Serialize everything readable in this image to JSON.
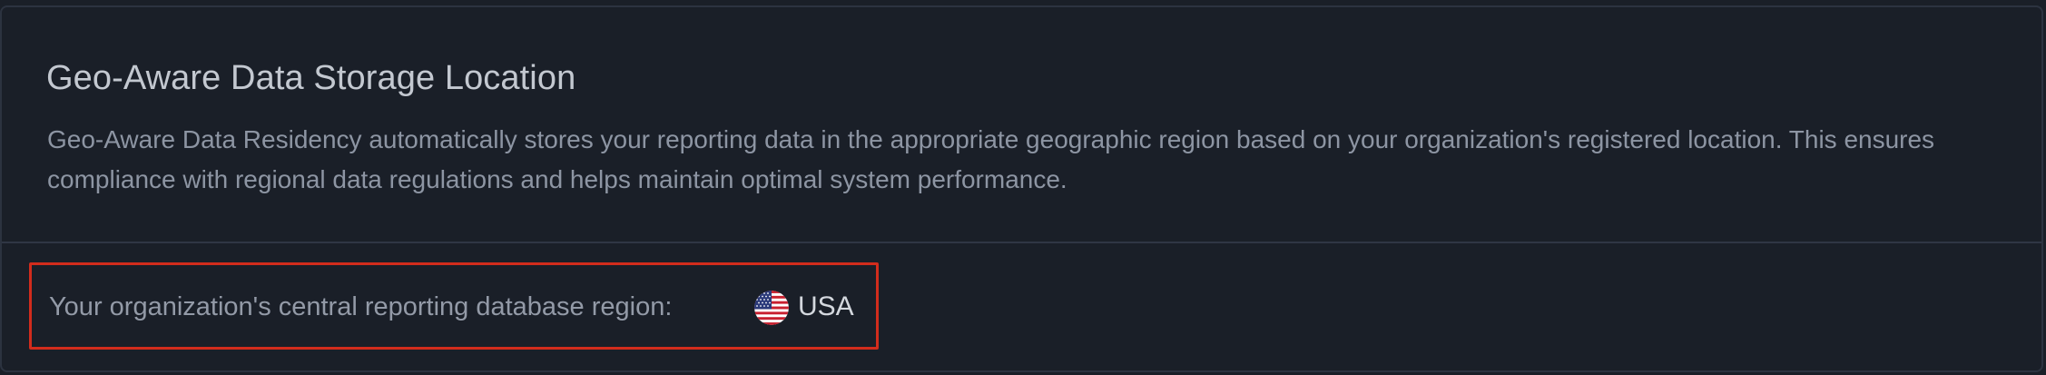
{
  "card": {
    "title": "Geo-Aware Data Storage Location",
    "description": "Geo-Aware Data Residency automatically stores your reporting data in the appropriate geographic region based on your organization's registered location. This ensures compliance with regional data regulations and helps maintain optimal system performance."
  },
  "region": {
    "label": "Your organization's central reporting database region:",
    "value": "USA",
    "flag_icon": "us-flag-icon"
  },
  "colors": {
    "background": "#1a1f28",
    "border": "#2c3340",
    "title": "#c3c8d0",
    "body_text": "#8d95a3",
    "highlight_border": "#d22c1c"
  }
}
